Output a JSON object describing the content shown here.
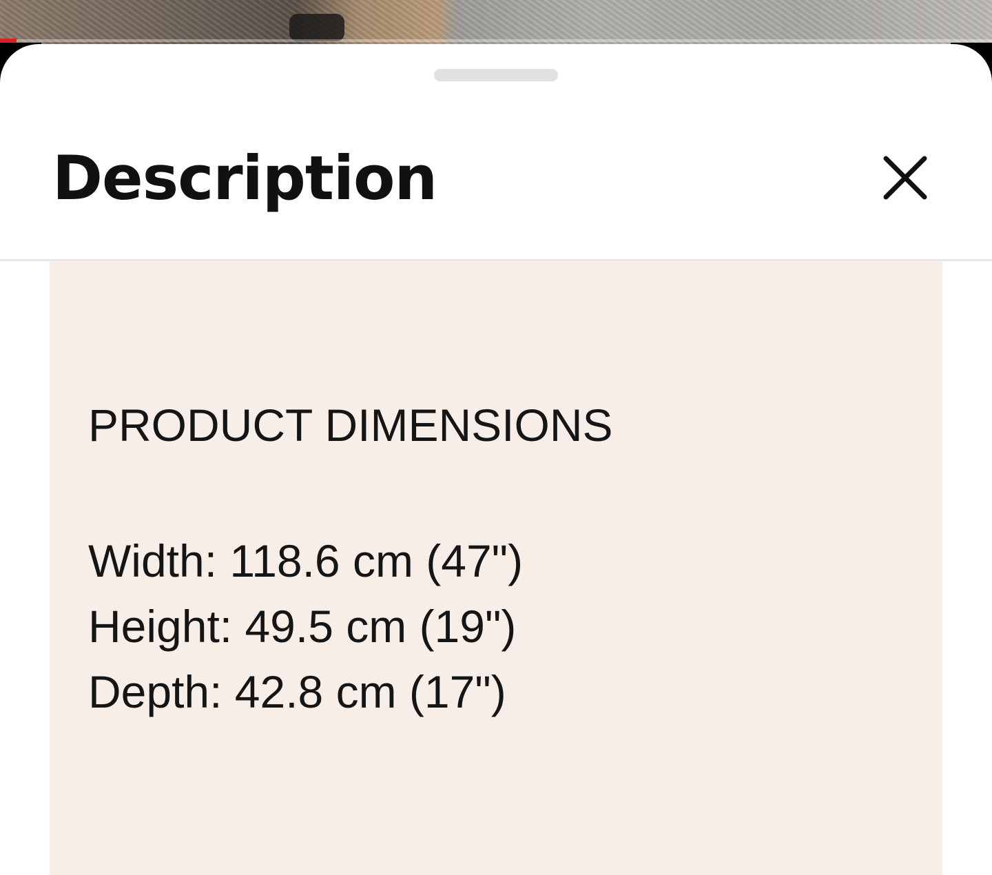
{
  "sheet": {
    "title": "Description",
    "close_icon": "close-icon"
  },
  "description": {
    "heading": "PRODUCT DIMENSIONS",
    "dimensions": [
      "Width: 118.6 cm (47\")",
      "Height: 49.5 cm (19\")",
      "Depth: 42.8 cm (17\")"
    ]
  },
  "colors": {
    "card_background": "#f7eee7",
    "sheet_background": "#ffffff",
    "text": "#111111",
    "progress_accent": "#e02020"
  }
}
